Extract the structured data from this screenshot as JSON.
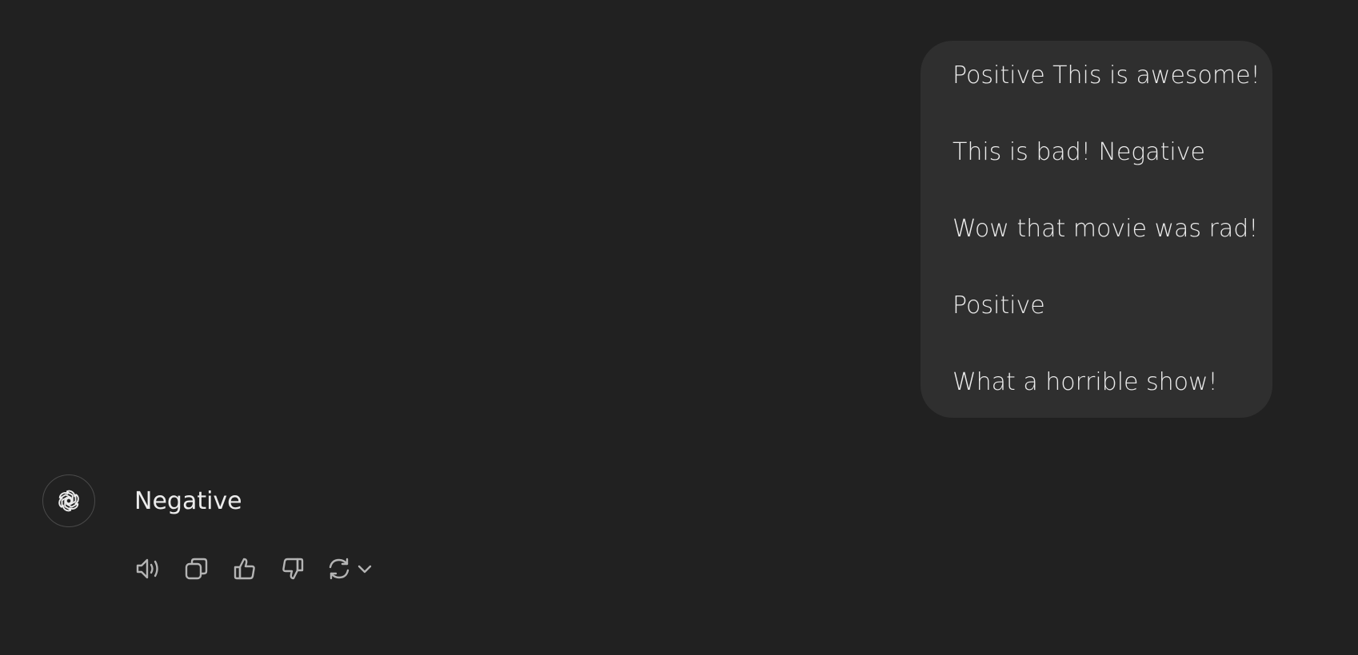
{
  "colors": {
    "background": "#212121",
    "bubble": "#2f2f2f",
    "text": "#ececec",
    "icon": "#b4b4b4"
  },
  "user_message": {
    "lines": [
      "Positive This is awesome!",
      "This is bad! Negative",
      "Wow that movie was rad!",
      "Positive",
      "What a horrible show!"
    ]
  },
  "assistant_message": {
    "avatar_icon": "openai-logo-icon",
    "text": "Negative",
    "actions": [
      {
        "name": "read-aloud",
        "icon": "speaker-icon"
      },
      {
        "name": "copy",
        "icon": "copy-icon"
      },
      {
        "name": "good-response",
        "icon": "thumbs-up-icon"
      },
      {
        "name": "bad-response",
        "icon": "thumbs-down-icon"
      },
      {
        "name": "regenerate",
        "icon": "refresh-icon"
      },
      {
        "name": "model-switcher",
        "icon": "chevron-down-icon"
      }
    ]
  }
}
